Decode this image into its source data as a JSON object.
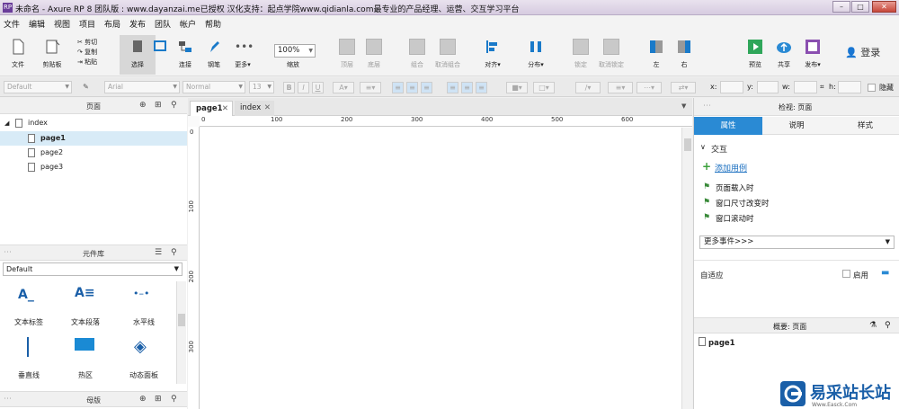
{
  "titlebar": {
    "title": "未命名 - Axure RP 8 团队版 : www.dayanzai.me已授权 汉化支持：起点学院www.qidianla.com最专业的产品经理、运营、交互学习平台",
    "app_icon": "RP",
    "min": "–",
    "max": "□",
    "close": "✕"
  },
  "menu": [
    "文件",
    "编辑",
    "视图",
    "项目",
    "布局",
    "发布",
    "团队",
    "帐户",
    "帮助"
  ],
  "toolbar": {
    "file": "文件",
    "clipboard": "剪贴板",
    "select": "选择",
    "connect": "连接",
    "pen": "钢笔",
    "more": "更多▾",
    "zoom_value": "100%",
    "zoom_label": "缩放",
    "top": "顶层",
    "bottom": "底层",
    "group": "组合",
    "ungroup": "取消组合",
    "align": "对齐▾",
    "distribute": "分布▾",
    "lock": "锁定",
    "unlock": "取消锁定",
    "left": "左",
    "right": "右",
    "preview": "预览",
    "share": "共享",
    "publish": "发布▾",
    "login": "登录",
    "cut": "剪切",
    "copy": "复制",
    "paste": "粘贴"
  },
  "format": {
    "style": "Default",
    "font": "Arial",
    "weight": "Normal",
    "size": "13",
    "bold": "B",
    "italic": "I",
    "underline": "U",
    "x_label": "x:",
    "y_label": "y:",
    "w_label": "w:",
    "h_label": "h:",
    "hide_label": "隐藏"
  },
  "pages": {
    "title": "页面",
    "items": [
      {
        "label": "index"
      },
      {
        "label": "page1"
      },
      {
        "label": "page2"
      },
      {
        "label": "page3"
      }
    ]
  },
  "library": {
    "title": "元件库",
    "selected": "Default",
    "widgets": [
      {
        "label": "文本标签"
      },
      {
        "label": "文本段落"
      },
      {
        "label": "水平线"
      },
      {
        "label": "垂直线"
      },
      {
        "label": "热区"
      },
      {
        "label": "动态面板"
      }
    ]
  },
  "masters": {
    "title": "母版"
  },
  "editor": {
    "tabs": [
      {
        "label": "page1"
      },
      {
        "label": "index"
      }
    ],
    "ruler_h": [
      "0",
      "100",
      "200",
      "300",
      "400",
      "500",
      "600"
    ],
    "ruler_v": [
      "0",
      "100",
      "200",
      "300"
    ]
  },
  "inspector": {
    "title": "检视: 页面",
    "tabs": [
      "属性",
      "说明",
      "样式"
    ],
    "section": "交互",
    "add_case": "添加用例",
    "events": [
      "页面载入时",
      "窗口尺寸改变时",
      "窗口滚动时"
    ],
    "more_events": "更多事件>>>",
    "adaptive": "自适应",
    "enable": "启用"
  },
  "outline": {
    "title": "概要: 页面",
    "item": "page1"
  },
  "watermark": {
    "text": "易采站长站",
    "sub": "Www.Easck.Com"
  },
  "colors": {
    "accent": "#2a8ad4",
    "title_bg": "#ddd2e6",
    "selected_bg": "#d8ebf7"
  }
}
